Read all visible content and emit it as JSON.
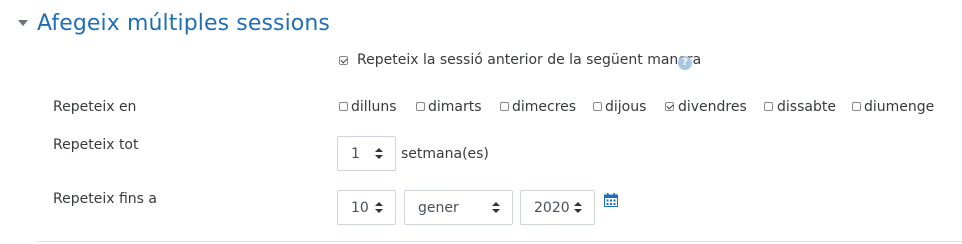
{
  "section": {
    "title": "Afegeix múltiples sessions"
  },
  "repeat_previous": {
    "label": "Repeteix la sessió anterior de la següent manera",
    "checked": true,
    "help_icon": "question-circle-icon"
  },
  "repeat_on": {
    "label": "Repeteix en",
    "days": [
      {
        "label": "dilluns",
        "checked": false
      },
      {
        "label": "dimarts",
        "checked": false
      },
      {
        "label": "dimecres",
        "checked": false
      },
      {
        "label": "dijous",
        "checked": false
      },
      {
        "label": "divendres",
        "checked": true
      },
      {
        "label": "dissabte",
        "checked": false
      },
      {
        "label": "diumenge",
        "checked": false
      }
    ]
  },
  "repeat_every": {
    "label": "Repeteix tot",
    "value": "1",
    "unit": "setmana(es)"
  },
  "repeat_until": {
    "label": "Repeteix fins a",
    "day": "10",
    "month": "gener",
    "year": "2020",
    "calendar_icon": "calendar-icon"
  },
  "colors": {
    "title": "#1f6fb7",
    "help_icon": "#a6c8e6",
    "text": "#373a3c",
    "border": "#ced4da"
  }
}
